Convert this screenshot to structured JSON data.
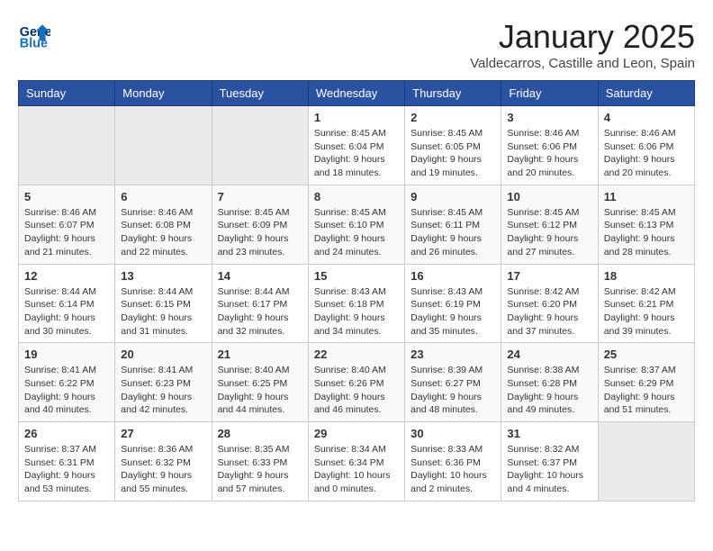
{
  "logo": {
    "line1": "General",
    "line2": "Blue"
  },
  "title": "January 2025",
  "subtitle": "Valdecarros, Castille and Leon, Spain",
  "weekdays": [
    "Sunday",
    "Monday",
    "Tuesday",
    "Wednesday",
    "Thursday",
    "Friday",
    "Saturday"
  ],
  "weeks": [
    [
      {
        "day": "",
        "info": ""
      },
      {
        "day": "",
        "info": ""
      },
      {
        "day": "",
        "info": ""
      },
      {
        "day": "1",
        "info": "Sunrise: 8:45 AM\nSunset: 6:04 PM\nDaylight: 9 hours\nand 18 minutes."
      },
      {
        "day": "2",
        "info": "Sunrise: 8:45 AM\nSunset: 6:05 PM\nDaylight: 9 hours\nand 19 minutes."
      },
      {
        "day": "3",
        "info": "Sunrise: 8:46 AM\nSunset: 6:06 PM\nDaylight: 9 hours\nand 20 minutes."
      },
      {
        "day": "4",
        "info": "Sunrise: 8:46 AM\nSunset: 6:06 PM\nDaylight: 9 hours\nand 20 minutes."
      }
    ],
    [
      {
        "day": "5",
        "info": "Sunrise: 8:46 AM\nSunset: 6:07 PM\nDaylight: 9 hours\nand 21 minutes."
      },
      {
        "day": "6",
        "info": "Sunrise: 8:46 AM\nSunset: 6:08 PM\nDaylight: 9 hours\nand 22 minutes."
      },
      {
        "day": "7",
        "info": "Sunrise: 8:45 AM\nSunset: 6:09 PM\nDaylight: 9 hours\nand 23 minutes."
      },
      {
        "day": "8",
        "info": "Sunrise: 8:45 AM\nSunset: 6:10 PM\nDaylight: 9 hours\nand 24 minutes."
      },
      {
        "day": "9",
        "info": "Sunrise: 8:45 AM\nSunset: 6:11 PM\nDaylight: 9 hours\nand 26 minutes."
      },
      {
        "day": "10",
        "info": "Sunrise: 8:45 AM\nSunset: 6:12 PM\nDaylight: 9 hours\nand 27 minutes."
      },
      {
        "day": "11",
        "info": "Sunrise: 8:45 AM\nSunset: 6:13 PM\nDaylight: 9 hours\nand 28 minutes."
      }
    ],
    [
      {
        "day": "12",
        "info": "Sunrise: 8:44 AM\nSunset: 6:14 PM\nDaylight: 9 hours\nand 30 minutes."
      },
      {
        "day": "13",
        "info": "Sunrise: 8:44 AM\nSunset: 6:15 PM\nDaylight: 9 hours\nand 31 minutes."
      },
      {
        "day": "14",
        "info": "Sunrise: 8:44 AM\nSunset: 6:17 PM\nDaylight: 9 hours\nand 32 minutes."
      },
      {
        "day": "15",
        "info": "Sunrise: 8:43 AM\nSunset: 6:18 PM\nDaylight: 9 hours\nand 34 minutes."
      },
      {
        "day": "16",
        "info": "Sunrise: 8:43 AM\nSunset: 6:19 PM\nDaylight: 9 hours\nand 35 minutes."
      },
      {
        "day": "17",
        "info": "Sunrise: 8:42 AM\nSunset: 6:20 PM\nDaylight: 9 hours\nand 37 minutes."
      },
      {
        "day": "18",
        "info": "Sunrise: 8:42 AM\nSunset: 6:21 PM\nDaylight: 9 hours\nand 39 minutes."
      }
    ],
    [
      {
        "day": "19",
        "info": "Sunrise: 8:41 AM\nSunset: 6:22 PM\nDaylight: 9 hours\nand 40 minutes."
      },
      {
        "day": "20",
        "info": "Sunrise: 8:41 AM\nSunset: 6:23 PM\nDaylight: 9 hours\nand 42 minutes."
      },
      {
        "day": "21",
        "info": "Sunrise: 8:40 AM\nSunset: 6:25 PM\nDaylight: 9 hours\nand 44 minutes."
      },
      {
        "day": "22",
        "info": "Sunrise: 8:40 AM\nSunset: 6:26 PM\nDaylight: 9 hours\nand 46 minutes."
      },
      {
        "day": "23",
        "info": "Sunrise: 8:39 AM\nSunset: 6:27 PM\nDaylight: 9 hours\nand 48 minutes."
      },
      {
        "day": "24",
        "info": "Sunrise: 8:38 AM\nSunset: 6:28 PM\nDaylight: 9 hours\nand 49 minutes."
      },
      {
        "day": "25",
        "info": "Sunrise: 8:37 AM\nSunset: 6:29 PM\nDaylight: 9 hours\nand 51 minutes."
      }
    ],
    [
      {
        "day": "26",
        "info": "Sunrise: 8:37 AM\nSunset: 6:31 PM\nDaylight: 9 hours\nand 53 minutes."
      },
      {
        "day": "27",
        "info": "Sunrise: 8:36 AM\nSunset: 6:32 PM\nDaylight: 9 hours\nand 55 minutes."
      },
      {
        "day": "28",
        "info": "Sunrise: 8:35 AM\nSunset: 6:33 PM\nDaylight: 9 hours\nand 57 minutes."
      },
      {
        "day": "29",
        "info": "Sunrise: 8:34 AM\nSunset: 6:34 PM\nDaylight: 10 hours\nand 0 minutes."
      },
      {
        "day": "30",
        "info": "Sunrise: 8:33 AM\nSunset: 6:36 PM\nDaylight: 10 hours\nand 2 minutes."
      },
      {
        "day": "31",
        "info": "Sunrise: 8:32 AM\nSunset: 6:37 PM\nDaylight: 10 hours\nand 4 minutes."
      },
      {
        "day": "",
        "info": ""
      }
    ]
  ]
}
